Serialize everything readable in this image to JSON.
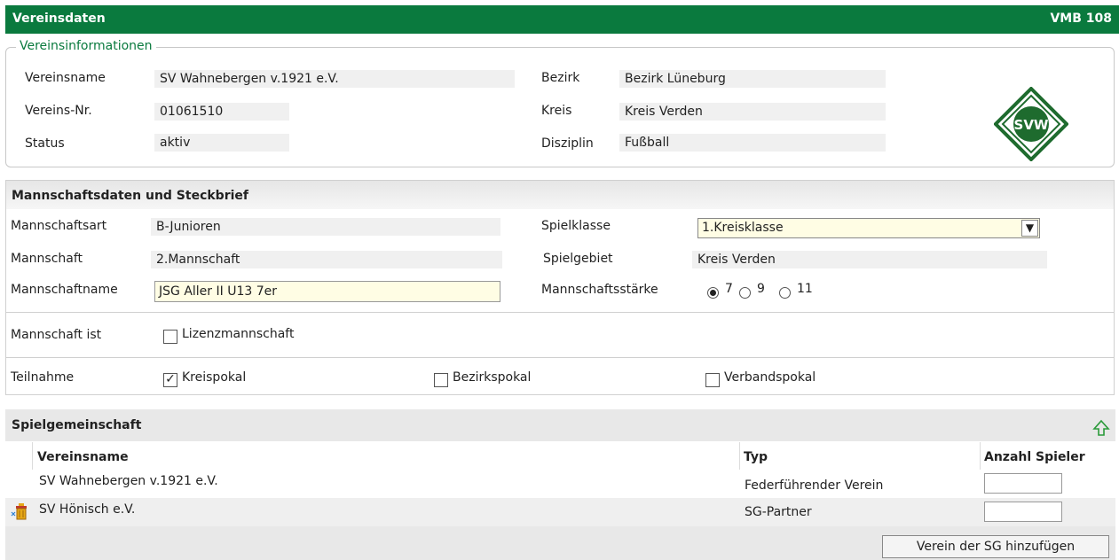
{
  "header": {
    "title": "Vereinsdaten",
    "code": "VMB 108"
  },
  "vereinsinfo": {
    "legend": "Vereinsinformationen",
    "name_label": "Vereinsname",
    "name_value": "SV Wahnebergen v.1921 e.V.",
    "nr_label": "Vereins-Nr.",
    "nr_value": "01061510",
    "status_label": "Status",
    "status_value": "aktiv",
    "bezirk_label": "Bezirk",
    "bezirk_value": "Bezirk Lüneburg",
    "kreis_label": "Kreis",
    "kreis_value": "Kreis Verden",
    "disziplin_label": "Disziplin",
    "disziplin_value": "Fußball",
    "logo_text": "SVW"
  },
  "mannschaft": {
    "title": "Mannschaftsdaten und Steckbrief",
    "art_label": "Mannschaftsart",
    "art_value": "B-Junioren",
    "mannschaft_label": "Mannschaft",
    "mannschaft_value": "2.Mannschaft",
    "name_label": "Mannschaftname",
    "name_value": "JSG Aller II U13 7er",
    "spielklasse_label": "Spielklasse",
    "spielklasse_value": "1.Kreisklasse",
    "spielgebiet_label": "Spielgebiet",
    "spielgebiet_value": "Kreis Verden",
    "staerke_label": "Mannschaftsstärke",
    "staerke_options": [
      "7",
      "9",
      "11"
    ],
    "staerke_selected": "7",
    "ist_label": "Mannschaft ist",
    "lizenz_label": "Lizenzmannschaft",
    "lizenz_checked": false,
    "teilnahme_label": "Teilnahme",
    "kreispokal_label": "Kreispokal",
    "kreispokal_checked": true,
    "bezirkspokal_label": "Bezirkspokal",
    "bezirkspokal_checked": false,
    "verbandspokal_label": "Verbandspokal",
    "verbandspokal_checked": false
  },
  "sg": {
    "title": "Spielgemeinschaft",
    "col_name": "Vereinsname",
    "col_typ": "Typ",
    "col_anzahl": "Anzahl Spieler",
    "rows": [
      {
        "name": "SV Wahnebergen v.1921 e.V.",
        "typ": "Federführender Verein"
      },
      {
        "name": "SV Hönisch e.V.",
        "typ": "SG-Partner"
      }
    ],
    "add_button": "Verein der SG hinzufügen"
  },
  "colors": {
    "accent": "#0a7a3e",
    "input_bg": "#fffde4"
  }
}
